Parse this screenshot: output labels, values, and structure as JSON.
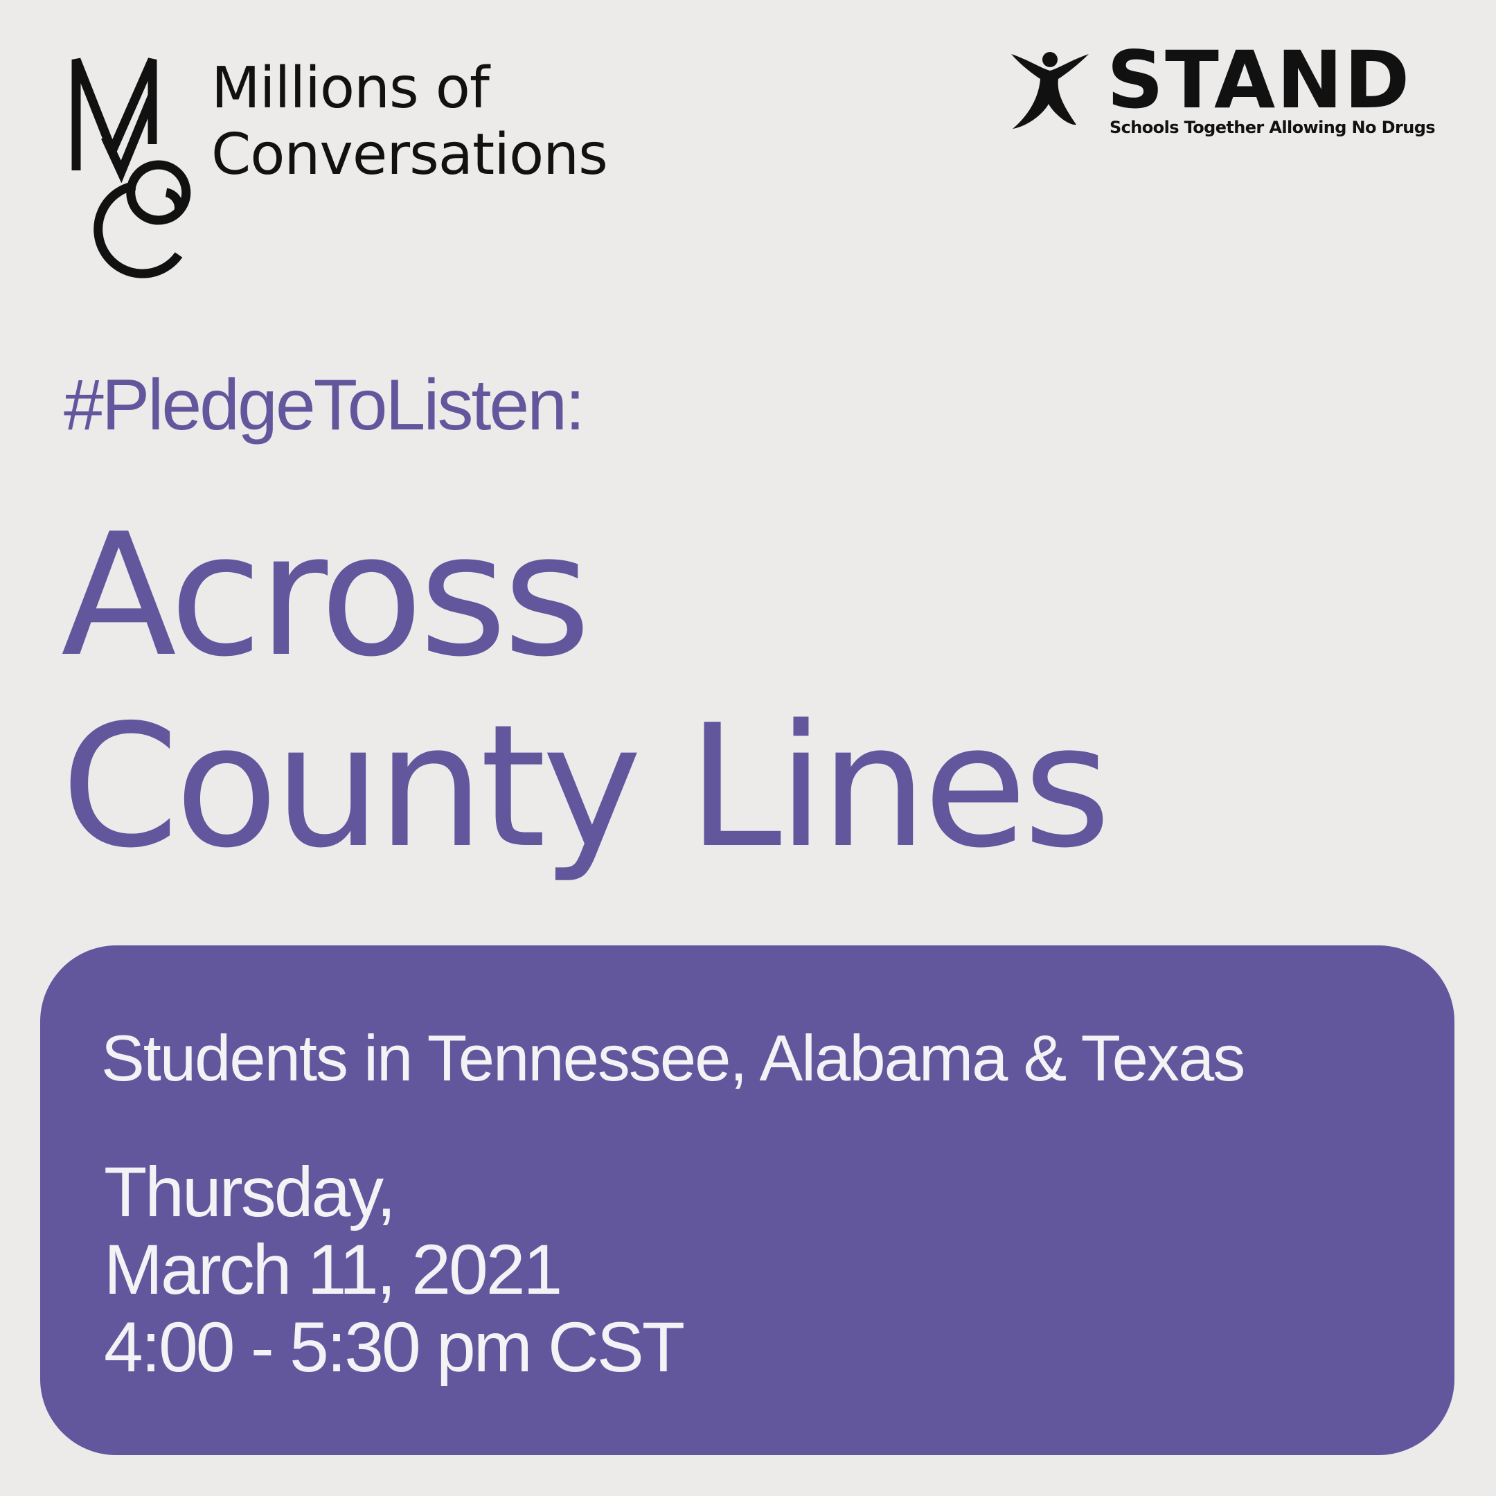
{
  "logos": {
    "moc": {
      "line1": "Millions of",
      "line2": "Conversations",
      "ink_color": "#111111"
    },
    "stand": {
      "name": "STAND",
      "tagline": "Schools Together Allowing No Drugs",
      "ink_color": "#111111"
    }
  },
  "headline": {
    "hashtag": "#PledgeToListen:",
    "title_line1": "Across",
    "title_line2": "County Lines"
  },
  "event": {
    "participants": "Students in Tennessee, Alabama & Texas",
    "day": "Thursday,",
    "date": "March 11, 2021",
    "time": "4:00 - 5:30 pm CST"
  },
  "colors": {
    "background": "#ecebe9",
    "accent_purple": "#62569d",
    "card_text": "#f3f2f5"
  }
}
